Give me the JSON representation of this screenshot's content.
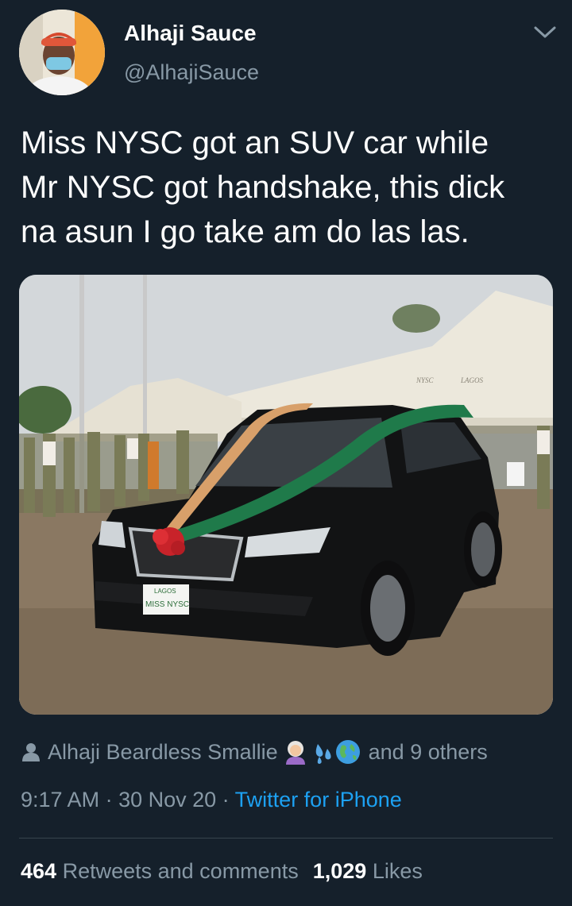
{
  "author": {
    "display_name": "Alhaji Sauce",
    "handle": "@AlhajiSauce"
  },
  "tweet": {
    "line1": "Miss NYSC got an SUV car while",
    "line2": "Mr NYSC got handshake, this dick",
    "line3": "na asun I go take am do las las."
  },
  "likers": {
    "name": "Alhaji Beardless Smallie",
    "suffix": "and 9 others",
    "emojis": [
      "older-woman-emoji",
      "sweat-droplets-emoji",
      "globe-emoji"
    ]
  },
  "meta": {
    "time": "9:17 AM",
    "separator": " · ",
    "date": "30 Nov 20",
    "source": "Twitter for iPhone"
  },
  "stats": {
    "retweets_count": "464",
    "retweets_label": "Retweets and comments",
    "likes_count": "1,029",
    "likes_label": "Likes"
  },
  "colors": {
    "background": "#15202b",
    "secondary_text": "#8899a6",
    "link": "#1da1f2",
    "divider": "#38444d"
  },
  "photo": {
    "plate_text_top": "LAGOS",
    "plate_text": "MISS NYSC",
    "tent_text_1": "NYSC",
    "tent_text_2": "LAGOS"
  }
}
